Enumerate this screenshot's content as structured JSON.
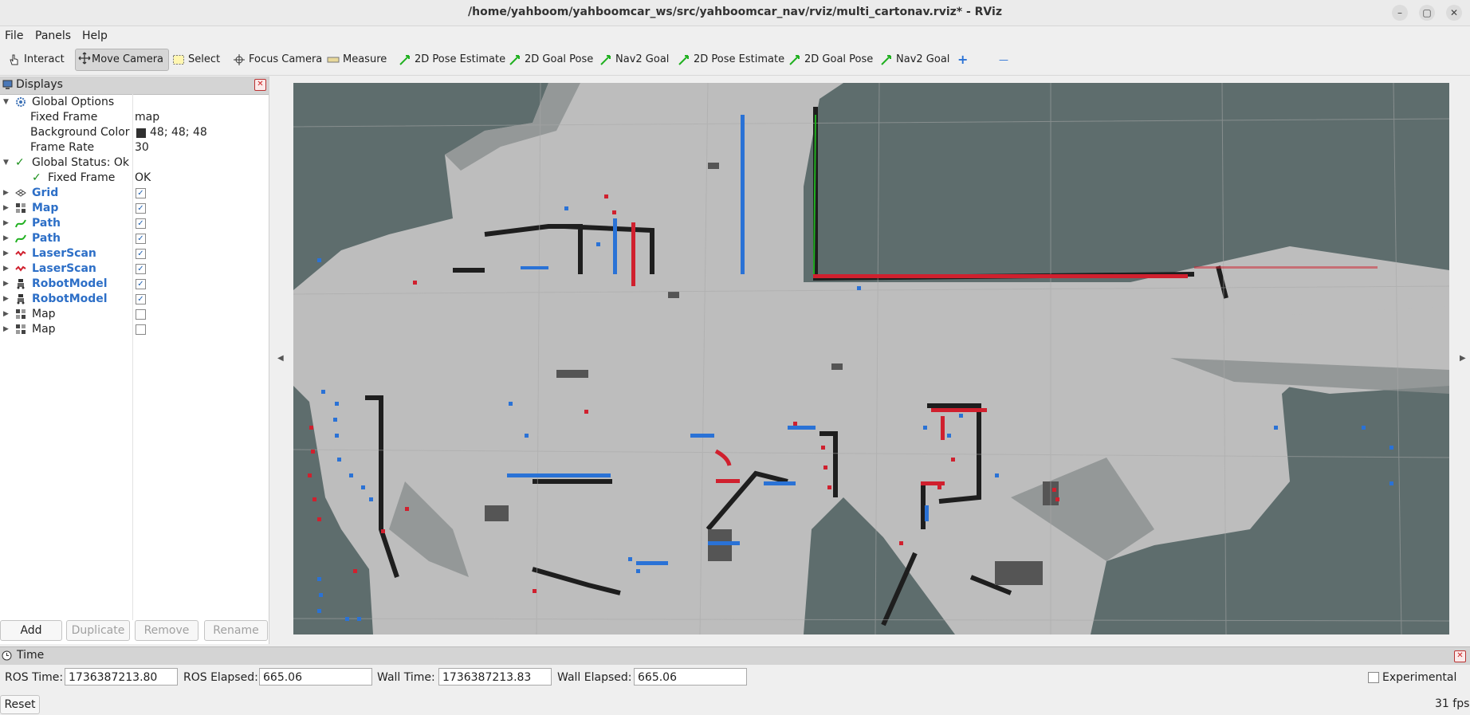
{
  "window": {
    "title": "/home/yahboom/yahboomcar_ws/src/yahboomcar_nav/rviz/multi_cartonav.rviz* - RViz",
    "controls": [
      "–",
      "▢",
      "✕"
    ]
  },
  "menu": [
    "File",
    "Panels",
    "Help"
  ],
  "toolbar": {
    "tools": [
      "Interact",
      "Move Camera",
      "Select",
      "Focus Camera",
      "Measure",
      "2D Pose Estimate",
      "2D Goal Pose",
      "Nav2 Goal",
      "2D Pose Estimate",
      "2D Goal Pose",
      "Nav2 Goal"
    ],
    "active_index": 1,
    "add_glyph": "+",
    "remove_glyph": "—"
  },
  "displays": {
    "title": "Displays",
    "global_options": "Global Options",
    "fixed_frame_label": "Fixed Frame",
    "fixed_frame_value": "map",
    "background_label": "Background Color",
    "background_value": "48; 48; 48",
    "frame_rate_label": "Frame Rate",
    "frame_rate_value": "30",
    "global_status": "Global Status: Ok",
    "status_fixed_frame_label": "Fixed Frame",
    "status_fixed_frame_value": "OK",
    "items": [
      {
        "name": "Grid",
        "checked": true,
        "enabled": true
      },
      {
        "name": "Map",
        "checked": true,
        "enabled": true
      },
      {
        "name": "Path",
        "checked": true,
        "enabled": true
      },
      {
        "name": "Path",
        "checked": true,
        "enabled": true
      },
      {
        "name": "LaserScan",
        "checked": true,
        "enabled": true
      },
      {
        "name": "LaserScan",
        "checked": true,
        "enabled": true
      },
      {
        "name": "RobotModel",
        "checked": true,
        "enabled": true
      },
      {
        "name": "RobotModel",
        "checked": true,
        "enabled": true
      },
      {
        "name": "Map",
        "checked": false,
        "enabled": false
      },
      {
        "name": "Map",
        "checked": false,
        "enabled": false
      }
    ],
    "buttons": {
      "add": "Add",
      "duplicate": "Duplicate",
      "remove": "Remove",
      "rename": "Rename"
    }
  },
  "time": {
    "title": "Time",
    "ros_time_label": "ROS Time:",
    "ros_time": "1736387213.80",
    "ros_elapsed_label": "ROS Elapsed:",
    "ros_elapsed": "665.06",
    "wall_time_label": "Wall Time:",
    "wall_time": "1736387213.83",
    "wall_elapsed_label": "Wall Elapsed:",
    "wall_elapsed": "665.06",
    "experimental_label": "Experimental",
    "experimental_checked": false,
    "reset_label": "Reset",
    "fps": "31 fps"
  },
  "colors": {
    "map_free": "#bdbdbd",
    "map_unknown": "#5e6d6d",
    "map_wall": "#1e1e1e",
    "scan_red": "#d0202e",
    "scan_blue": "#2a72d6",
    "path_green": "#20b020"
  }
}
